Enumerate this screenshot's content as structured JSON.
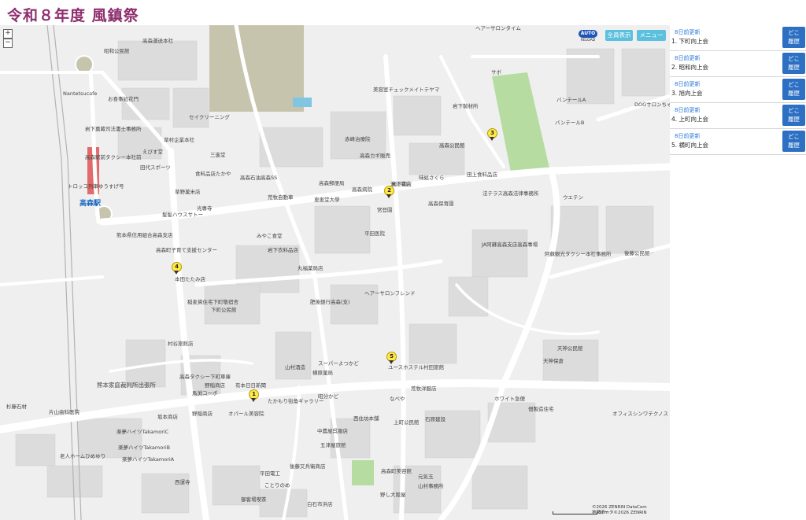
{
  "title": "令和８年度 風鎮祭",
  "map": {
    "zoom_in": "+",
    "zoom_out": "−",
    "auto_reload_label": "AUTO",
    "auto_reload_sub": "RELOAD",
    "show_all_label": "全員表示",
    "menu_label": "メニュー",
    "station_name": "高森駅",
    "attribution_line1": "©2026 ZENRIN DataCom",
    "attribution_line2": "地図データ©2026 ZENRIN",
    "scale_label": "50m",
    "markers": [
      "1",
      "2",
      "3",
      "4",
      "5"
    ],
    "labels": {
      "l01": "ヘアーサロンタイム",
      "l02": "高森運送本社",
      "l03": "昭和公民館",
      "l04": "Nantetsucafe",
      "l05": "お食事処花門",
      "l06": "岩下嘉蔵司法書士事務所",
      "l07": "セイクリーニング",
      "l08": "草村企業本社",
      "l09": "えびす堂",
      "l10": "高森駅前タクシー本社前",
      "l11": "田代スポーツ",
      "l12": "三進堂",
      "l13": "食料品店たかや",
      "l14": "トロッコ列車ゆうすげ号",
      "l15": "高森石油高森SS",
      "l16": "草野菓米店",
      "l17": "光專寺",
      "l18": "髪髪ハウスサトー",
      "l19": "熊本県信用組合高森支店",
      "l20": "高森町子育て支援センター",
      "l21": "みやこ食堂",
      "l22": "岩下衣料品店",
      "l23": "丸福薬局店",
      "l24": "本田たたみ店",
      "l25": "稲麦資住宅下町敬宿舎",
      "l26": "下町公民館",
      "l27": "村谷旅館店",
      "l28": "肥後銀行高森(支)",
      "l29": "ヘアーサロンフレンド",
      "l30": "山村酒造",
      "l31": "スーパーよつかど",
      "l32": "横原菓局",
      "l33": "ユースホステル村田旅館",
      "l34": "高森タクシー下町車庫",
      "l35": "野稲商店",
      "l36": "有本日日新聞",
      "l37": "馬渕コーポ",
      "l38": "熊本家庭裁判所出張所",
      "l39": "たかもり街角ギャラリー",
      "l40": "オパール美容院",
      "l41": "昭分かど",
      "l42": "荒牧洋服店",
      "l43": "ホワイト急便",
      "l44": "佃製造住宅",
      "l45": "オフィスシンワテクノス",
      "l46": "杉藤石材",
      "l47": "片山歯科医院",
      "l48": "坂本商店",
      "l49": "野稲商店",
      "l50": "楽夢ハイツTakamoriC",
      "l51": "楽夢ハイツTakamoriB",
      "l52": "老人ホームひめゆり",
      "l53": "楽夢ハイツTakamoriA",
      "l54": "西運寺",
      "l55": "平田電工",
      "l56": "ことりのめ",
      "l57": "御客場喫茶",
      "l58": "白石市浜店",
      "l59": "後藤又兵衛商店",
      "l60": "中農屋呉服店",
      "l61": "五津屋旅館",
      "l62": "西住坊本舗",
      "l63": "なべや",
      "l64": "上町公民館",
      "l65": "石原建設",
      "l66": "高森町美容館",
      "l67": "元気玉",
      "l68": "山村事務所",
      "l69": "野し大阪屋",
      "l70": "天神公民館",
      "l71": "天神保倉",
      "l72": "後藤公民館",
      "l73": "阿蘇観光タクシー本社事務所",
      "l74": "JA阿蘇高森支店高森事場",
      "l75": "高森保育園",
      "l76": "法テラス高森法律事務所",
      "l77": "ウエテン",
      "l78": "田上食料品店",
      "l79": "味処さくら",
      "l80": "高森郵便局",
      "l81": "高森病院",
      "l82": "宮登園",
      "l83": "平田医院",
      "l84": "高森カギ販売",
      "l85": "赤峰治療院",
      "l86": "美容室チェックメイトテヤマ",
      "l87": "岩下製材所",
      "l88": "高森公民館",
      "l89": "サボ",
      "l90": "バンテールA",
      "l91": "バンテールB",
      "l92": "DOGサロンちゃちゃ",
      "l93": "岩下書店",
      "l94": "恵恵堂大學",
      "l95": "荒牧自動車",
      "l96": "濱辺商店"
    }
  },
  "panel": {
    "items": [
      {
        "updated": "8日前更新",
        "name": "1.  下町向上会",
        "btn_line1": "どこ",
        "btn_line2": "履歴"
      },
      {
        "updated": "8日前更新",
        "name": "2.  昭和向上会",
        "btn_line1": "どこ",
        "btn_line2": "履歴"
      },
      {
        "updated": "8日前更新",
        "name": "3.  旭向上会",
        "btn_line1": "どこ",
        "btn_line2": "履歴"
      },
      {
        "updated": "8日前更新",
        "name": "4.  上町向上会",
        "btn_line1": "どこ",
        "btn_line2": "履歴"
      },
      {
        "updated": "8日前更新",
        "name": "5.  横町向上会",
        "btn_line1": "どこ",
        "btn_line2": "履歴"
      }
    ]
  },
  "colors": {
    "title": "#8f2f6e",
    "map_bg": "#efefef",
    "park": "#b7dca2",
    "field": "#c7c4ae",
    "station": "#e26a6a",
    "button": "#2c6fc3",
    "map_button": "#5bc0de"
  }
}
